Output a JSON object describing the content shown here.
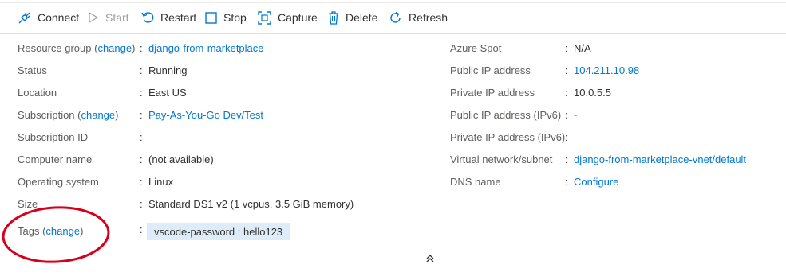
{
  "toolbar": {
    "connect": "Connect",
    "start": "Start",
    "restart": "Restart",
    "stop": "Stop",
    "capture": "Capture",
    "delete": "Delete",
    "refresh": "Refresh"
  },
  "left": {
    "resource_group": {
      "label": "Resource group (",
      "change": "change",
      "close": ")",
      "sep": ":",
      "value": "django-from-marketplace"
    },
    "status": {
      "label": "Status",
      "sep": ":",
      "value": "Running"
    },
    "location": {
      "label": "Location",
      "sep": ":",
      "value": "East US"
    },
    "subscription": {
      "label": "Subscription (",
      "change": "change",
      "close": ")",
      "sep": ":",
      "value": "Pay-As-You-Go Dev/Test"
    },
    "subscription_id": {
      "label": "Subscription ID",
      "sep": ":",
      "value": ""
    },
    "computer_name": {
      "label": "Computer name",
      "sep": ":",
      "value": "(not available)"
    },
    "os": {
      "label": "Operating system",
      "sep": ":",
      "value": "Linux"
    },
    "size": {
      "label": "Size",
      "sep": ":",
      "value": "Standard DS1 v2 (1 vcpus, 3.5 GiB memory)"
    },
    "tags": {
      "label": "Tags (",
      "change": "change",
      "close": ")",
      "sep": ":",
      "value": "vscode-password : hello123"
    }
  },
  "right": {
    "azure_spot": {
      "label": "Azure Spot",
      "sep": ":",
      "value": "N/A"
    },
    "public_ip": {
      "label": "Public IP address",
      "sep": ":",
      "value": "104.211.10.98"
    },
    "private_ip": {
      "label": "Private IP address",
      "sep": ":",
      "value": "10.0.5.5"
    },
    "public_ipv6": {
      "label": "Public IP address (IPv6)",
      "sep": ":",
      "value": "-"
    },
    "private_ipv6": {
      "label": "Private IP address (IPv6)",
      "sep": ":",
      "value": "-"
    },
    "vnet": {
      "label": "Virtual network/subnet",
      "sep": ":",
      "value": "django-from-marketplace-vnet/default"
    },
    "dns": {
      "label": "DNS name",
      "sep": ":",
      "value": "Configure"
    }
  },
  "colors": {
    "link": "#0078d4",
    "annotation_red": "#d6001c",
    "tag_bg": "#deecf9"
  }
}
